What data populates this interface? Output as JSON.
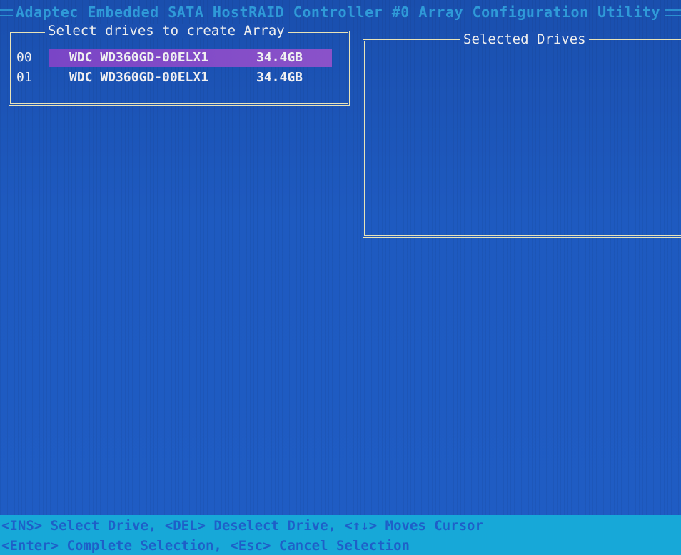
{
  "window": {
    "title": "Adaptec Embedded SATA HostRAID Controller #0 Array Configuration Utility"
  },
  "select_panel": {
    "title": "Select drives to create Array",
    "drives": [
      {
        "id": "00",
        "model": "WDC WD360GD-00ELX1",
        "size": "34.4GB",
        "highlighted": true
      },
      {
        "id": "01",
        "model": "WDC WD360GD-00ELX1",
        "size": "34.4GB",
        "highlighted": false
      }
    ]
  },
  "selected_panel": {
    "title": "Selected Drives",
    "drives": []
  },
  "status_bar": {
    "line1": "<INS> Select Drive, <DEL> Deselect Drive, <↑↓> Moves Cursor",
    "line2": "<Enter> Complete Selection, <Esc> Cancel Selection"
  },
  "colors": {
    "background": "#1d56b8",
    "highlight": "#7a45c6",
    "status_bar": "#17a8d8",
    "border": "#e9e4b8"
  }
}
